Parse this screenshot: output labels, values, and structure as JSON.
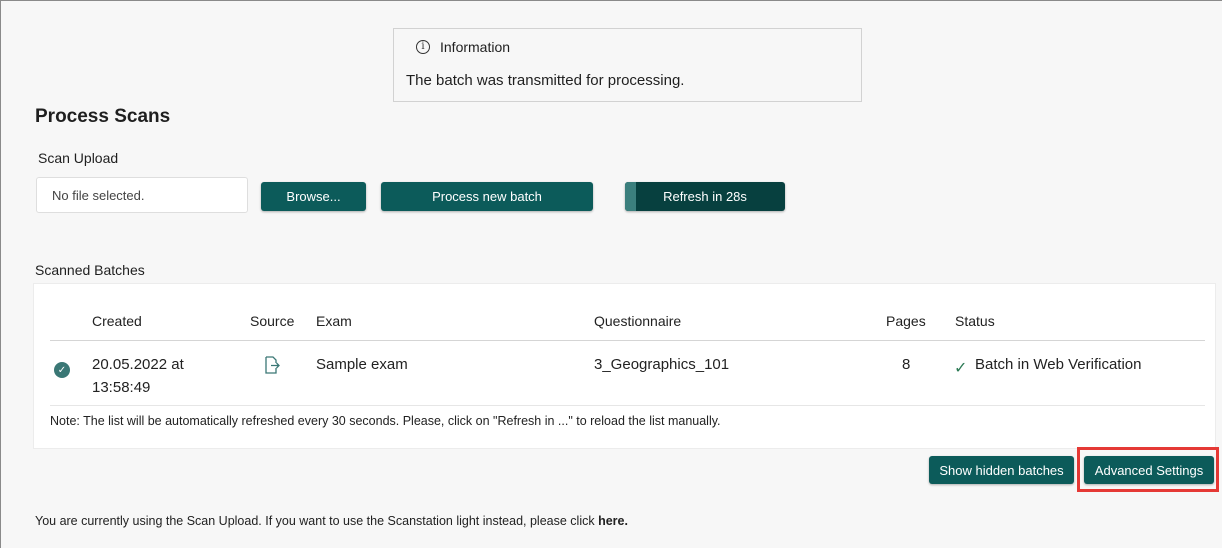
{
  "info": {
    "title": "Information",
    "message": "The batch was transmitted for processing."
  },
  "page": {
    "title": "Process Scans"
  },
  "upload": {
    "section_label": "Scan Upload",
    "file_status": "No file selected.",
    "browse_label": "Browse...",
    "process_label": "Process new batch",
    "refresh_label": "Refresh in 28s",
    "refresh_progress": 0.067
  },
  "batches": {
    "section_label": "Scanned Batches",
    "columns": {
      "created": "Created",
      "source": "Source",
      "exam": "Exam",
      "questionnaire": "Questionnaire",
      "pages": "Pages",
      "status": "Status"
    },
    "rows": [
      {
        "created_date": "20.05.2022 at",
        "created_time": "13:58:49",
        "exam": "Sample exam",
        "questionnaire": "3_Geographics_101",
        "pages": "8",
        "status": "Batch in Web Verification"
      }
    ],
    "note": "Note: The list will be automatically refreshed every 30 seconds. Please, click on \"Refresh in ...\" to reload the list manually."
  },
  "actions": {
    "show_hidden_label": "Show hidden batches",
    "advanced_label": "Advanced Settings"
  },
  "footer": {
    "text": "You are currently using the Scan Upload. If you want to use the Scanstation light instead, please click ",
    "link": "here."
  },
  "colors": {
    "primary": "#0c5b5a",
    "highlight": "#e53935",
    "status_check": "#2d7a55"
  },
  "icons": {
    "info": "info-circle-icon",
    "row_status": "check-circle-icon",
    "source": "file-export-icon",
    "status": "checkmark-icon"
  }
}
